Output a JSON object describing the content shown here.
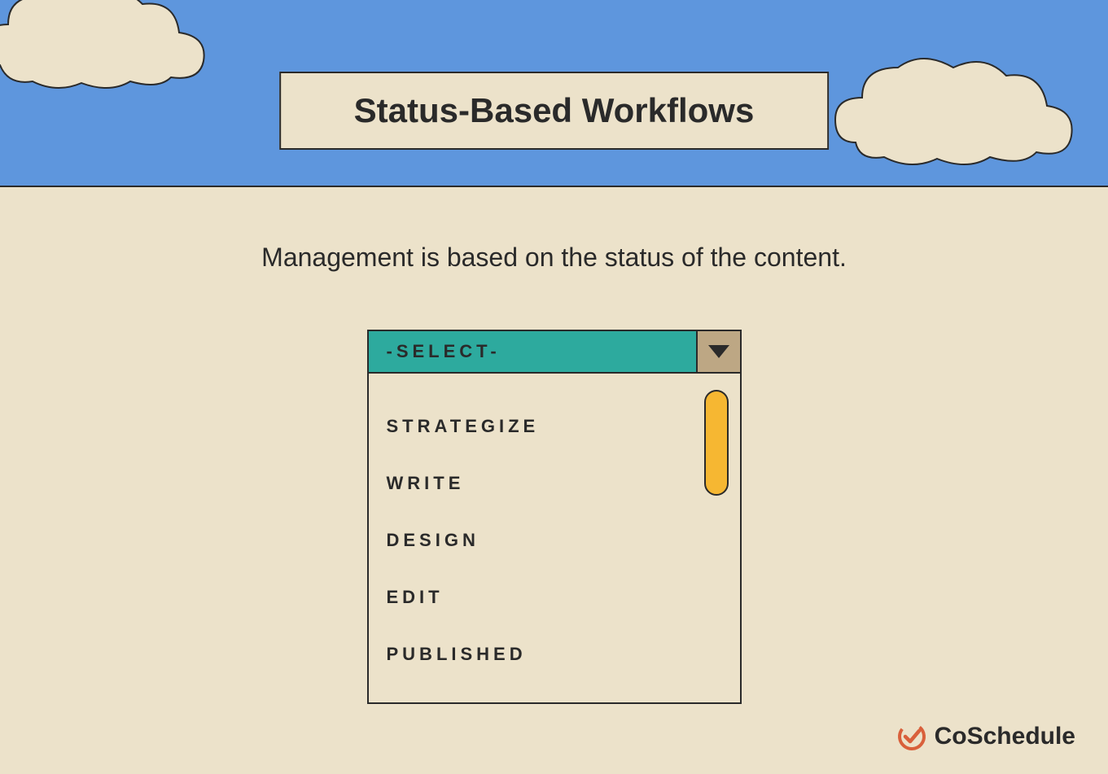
{
  "title": "Status-Based Workflows",
  "description": "Management is based on the status of the content.",
  "dropdown": {
    "selected": "-SELECT-",
    "options": [
      "STRATEGIZE",
      "WRITE",
      "DESIGN",
      "EDIT",
      "PUBLISHED"
    ]
  },
  "brand": "CoSchedule"
}
